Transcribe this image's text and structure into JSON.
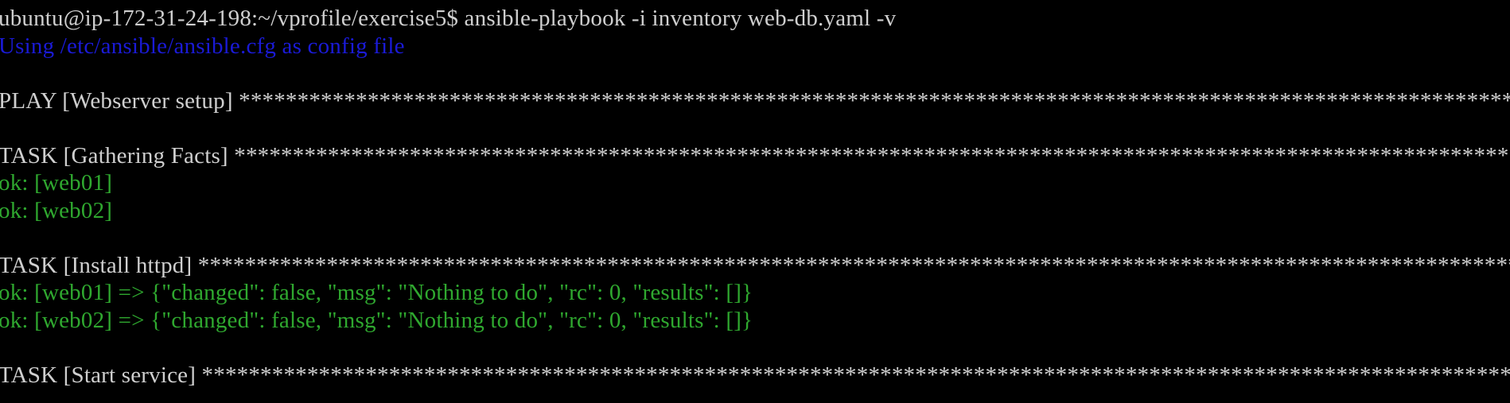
{
  "terminal": {
    "lines": [
      {
        "kind": "prompt",
        "text": "ubuntu@ip-172-31-24-198:~/vprofile/exercise5$ ansible-playbook -i inventory web-db.yaml -v"
      },
      {
        "kind": "info",
        "text": "Using /etc/ansible/ansible.cfg as config file"
      },
      {
        "kind": "blank",
        "text": ""
      },
      {
        "kind": "header",
        "text": "PLAY [Webserver setup] ****************************************************************************************************************************************************************"
      },
      {
        "kind": "blank",
        "text": ""
      },
      {
        "kind": "header",
        "text": "TASK [Gathering Facts] ****************************************************************************************************************************************************************"
      },
      {
        "kind": "ok",
        "text": "ok: [web01]"
      },
      {
        "kind": "ok",
        "text": "ok: [web02]"
      },
      {
        "kind": "blank",
        "text": ""
      },
      {
        "kind": "header",
        "text": "TASK [Install httpd] ******************************************************************************************************************************************************************"
      },
      {
        "kind": "ok",
        "text": "ok: [web01] => {\"changed\": false, \"msg\": \"Nothing to do\", \"rc\": 0, \"results\": []}"
      },
      {
        "kind": "ok",
        "text": "ok: [web02] => {\"changed\": false, \"msg\": \"Nothing to do\", \"rc\": 0, \"results\": []}"
      },
      {
        "kind": "blank",
        "text": ""
      },
      {
        "kind": "header",
        "text": "TASK [Start service] ******************************************************************************************************************************************************************"
      }
    ]
  },
  "colors": {
    "background": "#000000",
    "default_text": "#cfcfcf",
    "info_text": "#1a1ad6",
    "ok_text": "#2fa82f"
  }
}
